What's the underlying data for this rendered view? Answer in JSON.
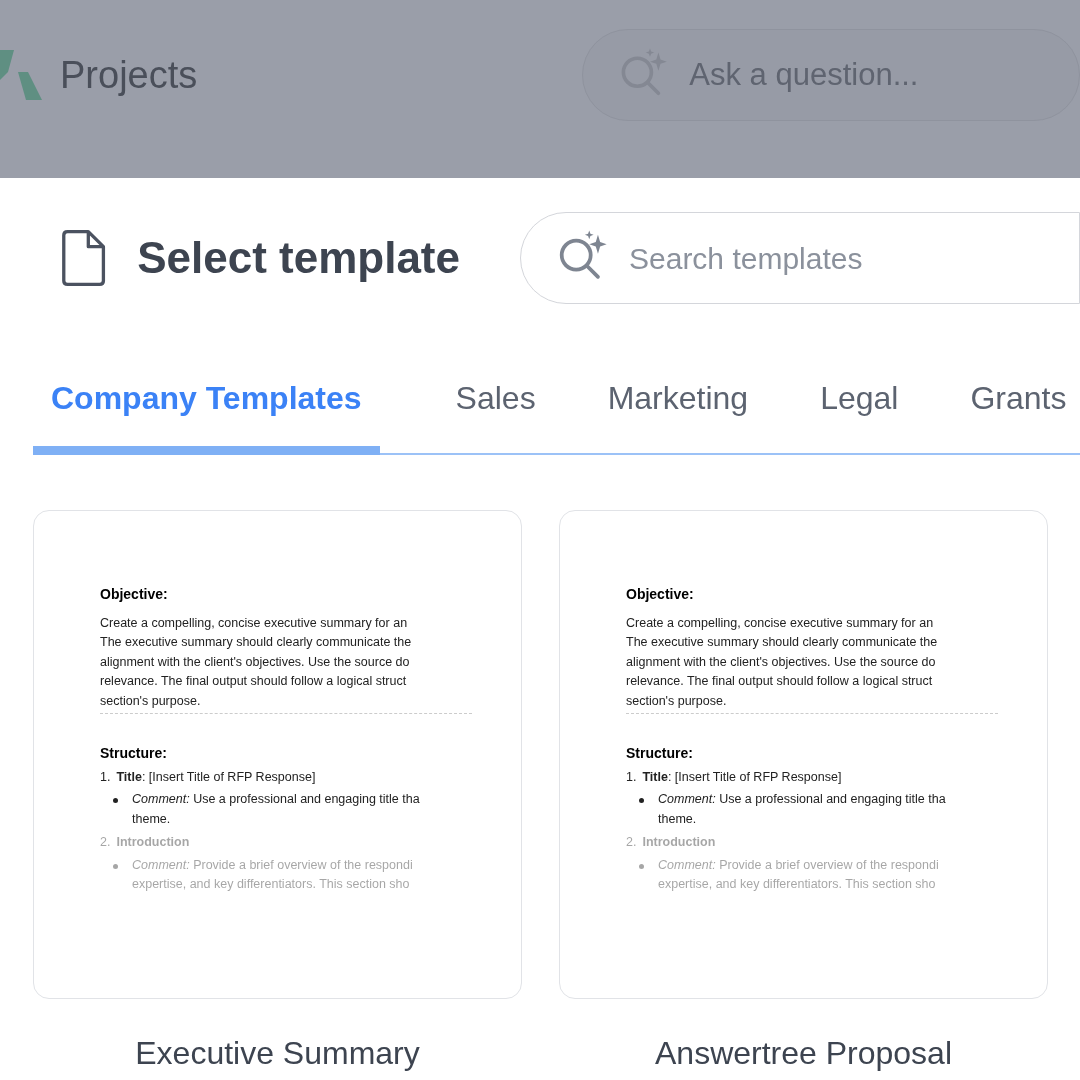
{
  "background": {
    "title": "Projects",
    "ask_field": {
      "placeholder": "Ask a question..."
    }
  },
  "dialog": {
    "title": "Select template",
    "search": {
      "placeholder": "Search templates"
    },
    "tabs": [
      {
        "label": "Company Templates",
        "selected": true
      },
      {
        "label": "Sales",
        "selected": false
      },
      {
        "label": "Marketing",
        "selected": false
      },
      {
        "label": "Legal",
        "selected": false
      },
      {
        "label": "Grants",
        "selected": false
      }
    ],
    "templates": [
      {
        "name": "Executive Summary",
        "preview": {
          "objective_heading": "Objective:",
          "objective_lines": [
            "Create a compelling, concise executive summary for an",
            "The executive summary should clearly communicate the",
            "alignment with the client's objectives. Use the source do",
            "relevance. The final output should follow a logical struct",
            "section's purpose."
          ],
          "structure_heading": "Structure:",
          "items": [
            {
              "number": "1.",
              "heading": "**Title**: [Insert Title of RFP Response]",
              "comment_lines": [
                "*Comment:* Use a professional and engaging title tha",
                "theme."
              ],
              "faded": false
            },
            {
              "number": "2.",
              "heading": "**Introduction**",
              "comment_lines": [
                "*Comment:* Provide a brief overview of the respondi",
                "expertise, and key differentiators. This section sho"
              ],
              "faded": true
            }
          ]
        }
      },
      {
        "name": "Answertree Proposal",
        "preview": {
          "objective_heading": "Objective:",
          "objective_lines": [
            "Create a compelling, concise executive summary for an",
            "The executive summary should clearly communicate the",
            "alignment with the client's objectives. Use the source do",
            "relevance. The final output should follow a logical struct",
            "section's purpose."
          ],
          "structure_heading": "Structure:",
          "items": [
            {
              "number": "1.",
              "heading": "**Title**: [Insert Title of RFP Response]",
              "comment_lines": [
                "*Comment:* Use a professional and engaging title tha",
                "theme."
              ],
              "faded": false
            },
            {
              "number": "2.",
              "heading": "**Introduction**",
              "comment_lines": [
                "*Comment:* Provide a brief overview of the respondi",
                "expertise, and key differentiators. This section sho"
              ],
              "faded": true
            }
          ]
        }
      }
    ]
  }
}
